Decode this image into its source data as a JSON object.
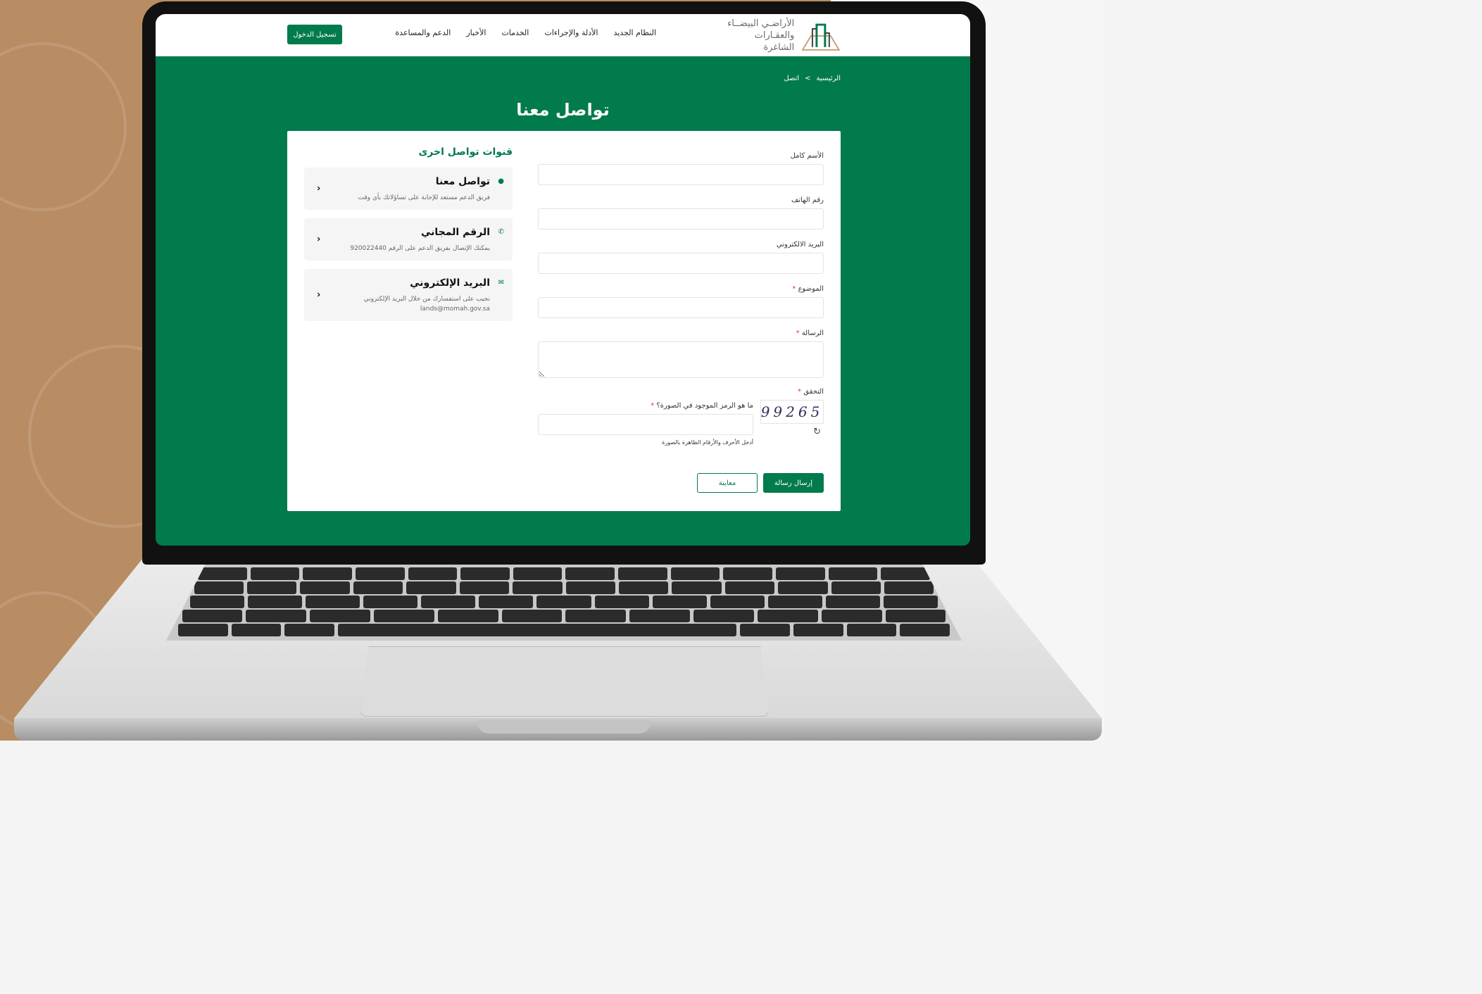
{
  "header": {
    "logo_line1": "الأراضـي البيضــاء",
    "logo_line2": "والعقـارات الشاغرة",
    "nav": [
      {
        "label": "النظام الجديد"
      },
      {
        "label": "الأدلة والإجراءات"
      },
      {
        "label": "الخدمات"
      },
      {
        "label": "الأخبار"
      },
      {
        "label": "الدعم والمساعدة"
      }
    ],
    "login_label": "تسجيل الدخول"
  },
  "breadcrumb": {
    "home": "الرئيسية",
    "separator": ">",
    "current": "اتصل"
  },
  "page_title": "تواصل معنا",
  "form": {
    "full_name_label": "الأسم كامل",
    "phone_label": "رقم الهاتف",
    "email_label": "البريد الالكتروني",
    "subject_label": "الموضوع",
    "message_label": "الرسالة",
    "verify_label": "التحقق",
    "required_mark": "*",
    "captcha_code": "99265",
    "captcha_question": "ما هو الرمز الموجود في الصورة؟",
    "captcha_help": "أدخل الأحرف والأرقام الظاهرة بالصورة",
    "send_label": "إرسال رسالة",
    "preview_label": "معاينة"
  },
  "channels": {
    "title": "قنوات تواصل اخرى",
    "items": [
      {
        "title": "تواصل معنا",
        "desc": "فريق الدعم مستعد للإجابة على تساؤلاتك بأي وقت",
        "icon": "whatsapp-icon"
      },
      {
        "title": "الرقم المجاني",
        "desc": "يمكنك الإتصال بفريق الدعم على الرقم 920022440",
        "icon": "phone-icon"
      },
      {
        "title": "البريد الإلكتروني",
        "desc": "نجيب على استفسارك من خلال البريد الإلكتروني",
        "desc2": "lands@momah.gov.sa",
        "icon": "mail-icon"
      }
    ]
  },
  "colors": {
    "brand_green": "#017a4c",
    "tan_background": "#b88d63"
  }
}
